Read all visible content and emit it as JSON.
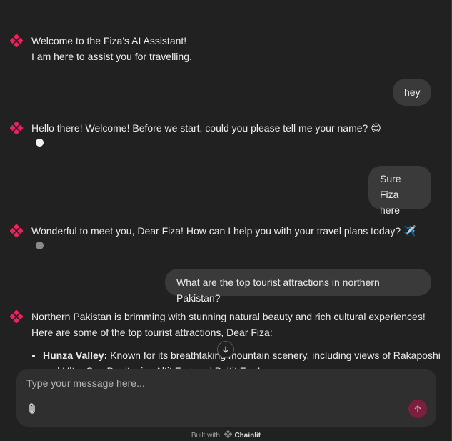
{
  "conversation": {
    "bot_messages": [
      {
        "lines": [
          "Welcome to the Fiza's AI Assistant!",
          "I am here to assist you for travelling."
        ]
      },
      {
        "lines": [
          "Hello there! Welcome! Before we start, could you please tell me your name? 😊"
        ]
      },
      {
        "lines": [
          "Wonderful to meet you, Dear Fiza! How can I help you with your travel plans today? ✈️"
        ]
      },
      {
        "lines": [
          "Northern Pakistan is brimming with stunning natural beauty and rich cultural experiences!",
          "Here are some of the top tourist attractions, Dear Fiza:"
        ]
      }
    ],
    "user_messages": [
      {
        "lines": [
          "hey"
        ]
      },
      {
        "lines": [
          "Sure",
          "Fiza here"
        ]
      },
      {
        "lines": [
          "What are the top tourist attractions in northern Pakistan?"
        ]
      }
    ],
    "attractions": [
      {
        "name": "Hunza Valley:",
        "description": " Known for its breathtaking mountain scenery, including views of Rakaposhi and Ultar Sar. Don't miss Altit Fort and Baltit Fort!"
      }
    ]
  },
  "composer": {
    "placeholder": "Type your message here..."
  },
  "footer": {
    "built_with": "Built with",
    "brand": "Chainlit"
  },
  "icons": {
    "logo": "chainlit-diamond-icon",
    "attach": "paperclip-icon",
    "send": "arrow-up-icon",
    "scroll": "arrow-down-icon"
  },
  "colors": {
    "background": "#212121",
    "bubble": "#3a3a3a",
    "composer": "#2f2f2f",
    "logo": "#e8245f",
    "send": "#7a1f3d",
    "loader_dot_1": "#f2f2f2",
    "loader_dot_2": "#8a8a8a"
  }
}
